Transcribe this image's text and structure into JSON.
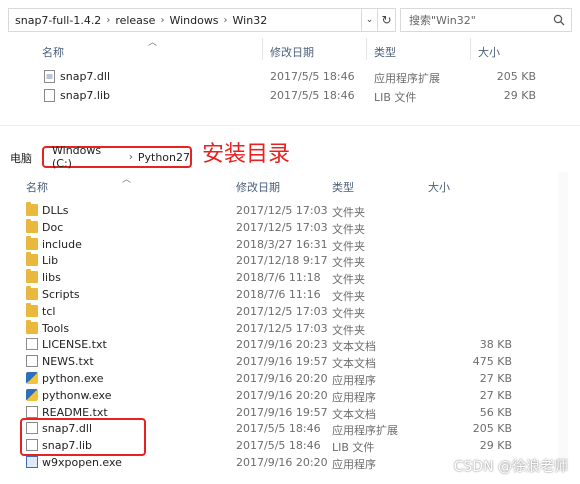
{
  "top": {
    "breadcrumb": [
      "snap7-full-1.4.2",
      "release",
      "Windows",
      "Win32"
    ],
    "search_placeholder": "搜索\"Win32\"",
    "columns": {
      "name": "名称",
      "date": "修改日期",
      "type": "类型",
      "size": "大小"
    },
    "files": [
      {
        "name": "snap7.dll",
        "date": "2017/5/5 18:46",
        "type": "应用程序扩展",
        "size": "205 KB"
      },
      {
        "name": "snap7.lib",
        "date": "2017/5/5 18:46",
        "type": "LIB 文件",
        "size": "29 KB"
      }
    ]
  },
  "bottom": {
    "pc_label": "电脑",
    "breadcrumb": [
      "Windows (C:)",
      "Python27"
    ],
    "annotation": "安装目录",
    "columns": {
      "name": "名称",
      "date": "修改日期",
      "type": "类型",
      "size": "大小"
    },
    "files": [
      {
        "icon": "folder-icon",
        "name": "DLLs",
        "date": "2017/12/5 17:03",
        "type": "文件夹",
        "size": ""
      },
      {
        "icon": "folder-icon",
        "name": "Doc",
        "date": "2017/12/5 17:03",
        "type": "文件夹",
        "size": ""
      },
      {
        "icon": "folder-icon",
        "name": "include",
        "date": "2018/3/27 16:31",
        "type": "文件夹",
        "size": ""
      },
      {
        "icon": "folder-icon",
        "name": "Lib",
        "date": "2017/12/18 9:17",
        "type": "文件夹",
        "size": ""
      },
      {
        "icon": "folder-icon",
        "name": "libs",
        "date": "2018/7/6 11:18",
        "type": "文件夹",
        "size": ""
      },
      {
        "icon": "folder-icon",
        "name": "Scripts",
        "date": "2018/7/6 11:16",
        "type": "文件夹",
        "size": ""
      },
      {
        "icon": "folder-icon",
        "name": "tcl",
        "date": "2017/12/5 17:03",
        "type": "文件夹",
        "size": ""
      },
      {
        "icon": "folder-icon",
        "name": "Tools",
        "date": "2017/12/5 17:03",
        "type": "文件夹",
        "size": ""
      },
      {
        "icon": "text-file-icon",
        "name": "LICENSE.txt",
        "date": "2017/9/16 20:23",
        "type": "文本文档",
        "size": "38 KB"
      },
      {
        "icon": "text-file-icon",
        "name": "NEWS.txt",
        "date": "2017/9/16 19:57",
        "type": "文本文档",
        "size": "475 KB"
      },
      {
        "icon": "python-exe-icon",
        "name": "python.exe",
        "date": "2017/9/16 20:20",
        "type": "应用程序",
        "size": "27 KB"
      },
      {
        "icon": "python-exe-icon",
        "name": "pythonw.exe",
        "date": "2017/9/16 20:20",
        "type": "应用程序",
        "size": "27 KB"
      },
      {
        "icon": "text-file-icon",
        "name": "README.txt",
        "date": "2017/9/16 19:57",
        "type": "文本文档",
        "size": "56 KB"
      },
      {
        "icon": "dll-file-icon",
        "name": "snap7.dll",
        "date": "2017/5/5 18:46",
        "type": "应用程序扩展",
        "size": "205 KB"
      },
      {
        "icon": "lib-file-icon",
        "name": "snap7.lib",
        "date": "2017/5/5 18:46",
        "type": "LIB 文件",
        "size": "29 KB"
      },
      {
        "icon": "exe-icon",
        "name": "w9xpopen.exe",
        "date": "2017/9/16 20:20",
        "type": "应用程序",
        "size": ""
      }
    ]
  },
  "watermark": "CSDN @徐浪老师"
}
